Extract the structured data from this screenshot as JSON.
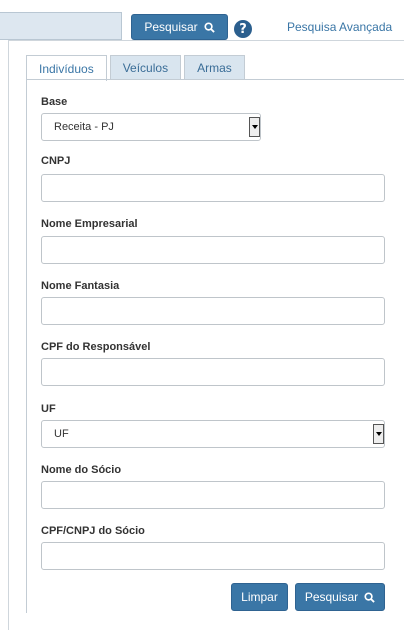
{
  "topbar": {
    "search_button": "Pesquisar",
    "help": "?",
    "advanced_link": "Pesquisa Avançada"
  },
  "tabs": [
    {
      "label": "Indivíduos",
      "active": true
    },
    {
      "label": "Veículos",
      "active": false
    },
    {
      "label": "Armas",
      "active": false
    }
  ],
  "form": {
    "base_label": "Base",
    "base_value": "Receita - PJ",
    "cnpj_label": "CNPJ",
    "cnpj_value": "",
    "nome_empresarial_label": "Nome Empresarial",
    "nome_empresarial_value": "",
    "nome_fantasia_label": "Nome Fantasia",
    "nome_fantasia_value": "",
    "cpf_responsavel_label": "CPF do Responsável",
    "cpf_responsavel_value": "",
    "uf_label": "UF",
    "uf_value": "UF",
    "nome_socio_label": "Nome do Sócio",
    "nome_socio_value": "",
    "cpf_cnpj_socio_label": "CPF/CNPJ do Sócio",
    "cpf_cnpj_socio_value": ""
  },
  "actions": {
    "clear_button": "Limpar",
    "search_button": "Pesquisar"
  },
  "colors": {
    "primary": "#3a76a6",
    "help_icon": "#2b5f8e",
    "tab_inactive_bg": "#d9e5ef"
  }
}
